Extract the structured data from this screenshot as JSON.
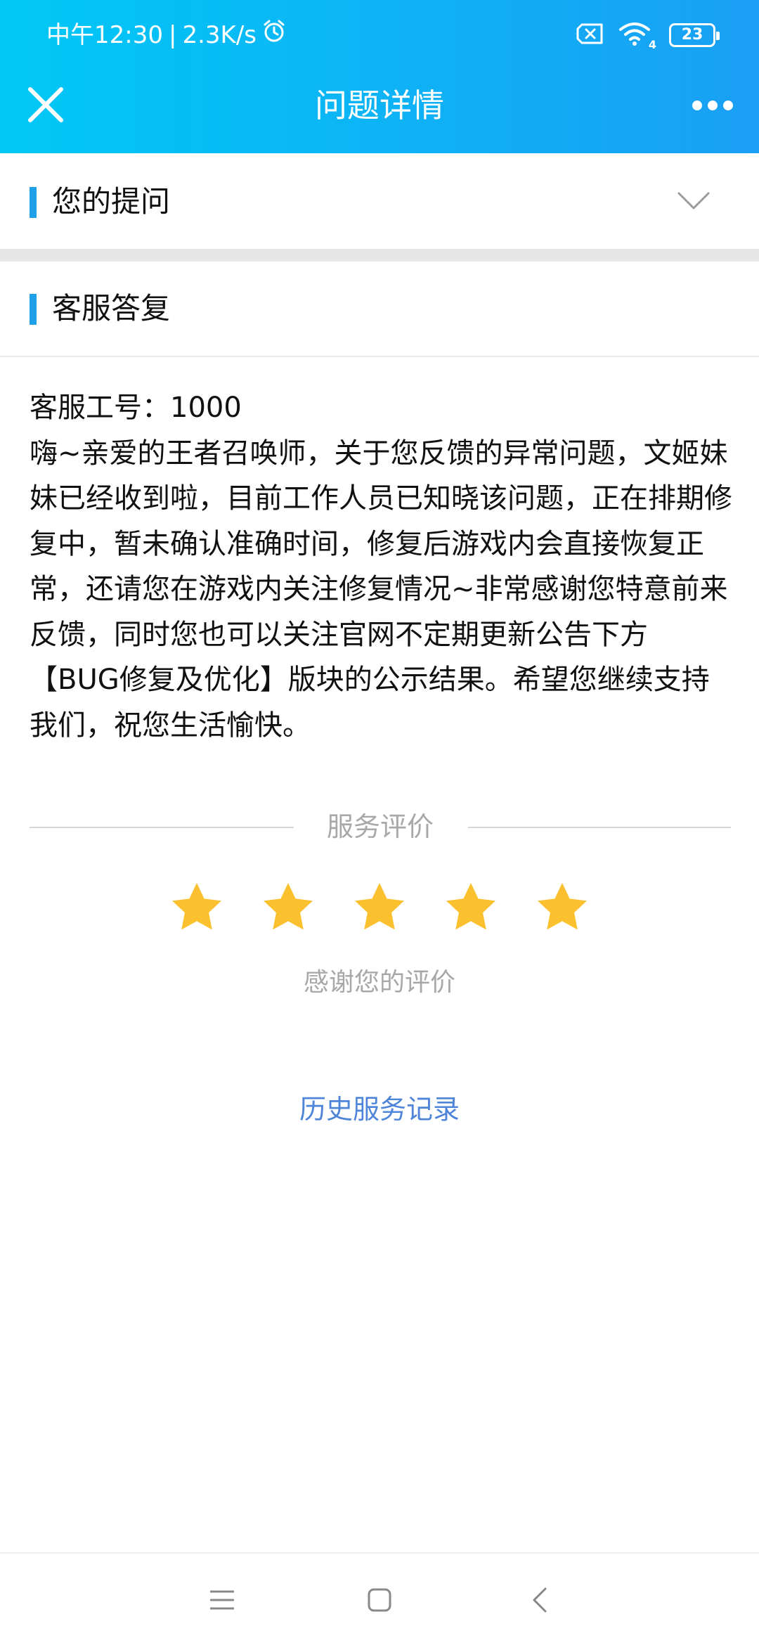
{
  "status_bar": {
    "time": "中午12:30",
    "separator": "|",
    "speed": "2.3K/s",
    "battery": "23",
    "wifi_badge": "4",
    "icons": [
      "alarm-icon",
      "sim-off-icon",
      "wifi-icon",
      "battery-icon"
    ]
  },
  "title_bar": {
    "title": "问题详情",
    "icons": [
      "close-icon",
      "more-icon"
    ]
  },
  "sections": {
    "question_label": "您的提问",
    "reply_label": "客服答复"
  },
  "reply": {
    "agent_id": "客服工号：1000",
    "body": "嗨~亲爱的王者召唤师，关于您反馈的异常问题，文姬妹妹已经收到啦，目前工作人员已知晓该问题，正在排期修复中，暂未确认准确时间，修复后游戏内会直接恢复正常，还请您在游戏内关注修复情况~非常感谢您特意前来反馈，同时您也可以关注官网不定期更新公告下方【BUG修复及优化】版块的公示结果。希望您继续支持我们，祝您生活愉快。"
  },
  "rating": {
    "title": "服务评价",
    "stars_filled": 5,
    "stars_total": 5,
    "thanks": "感谢您的评价"
  },
  "history_link": "历史服务记录",
  "colors": {
    "header_start": "#00c8f6",
    "header_end": "#1a9ff4",
    "accent": "#1ea0e8",
    "star": "#fbc02d",
    "link": "#4f85d8",
    "muted": "#a8a8a8"
  },
  "nav_bar": {
    "icons": [
      "menu-icon",
      "home-icon",
      "back-icon"
    ]
  }
}
